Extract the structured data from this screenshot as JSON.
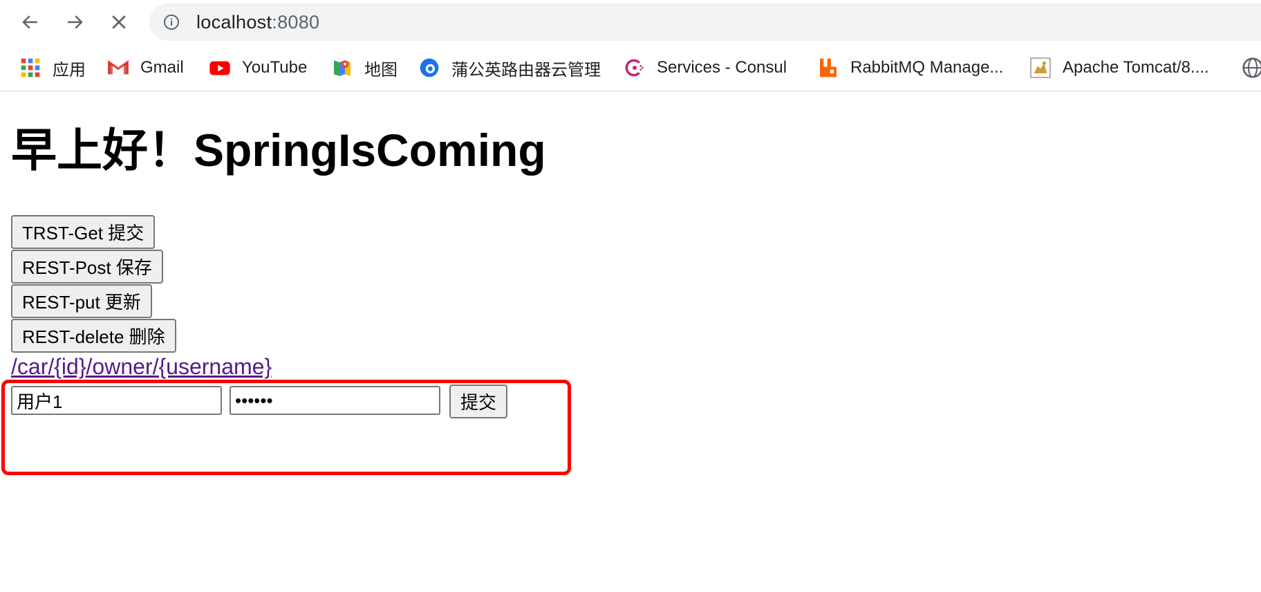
{
  "browser": {
    "url_host": "localhost",
    "url_port": ":8080"
  },
  "bookmarks": [
    {
      "label": "应用",
      "icon": "apps-grid-icon"
    },
    {
      "label": "Gmail",
      "icon": "gmail-icon"
    },
    {
      "label": "YouTube",
      "icon": "youtube-icon"
    },
    {
      "label": "地图",
      "icon": "maps-icon"
    },
    {
      "label": "蒲公英路由器云管理",
      "icon": "pugongying-icon"
    },
    {
      "label": "Services - Consul",
      "icon": "consul-icon"
    },
    {
      "label": "RabbitMQ Manage...",
      "icon": "rabbitmq-icon"
    },
    {
      "label": "Apache Tomcat/8....",
      "icon": "tomcat-icon"
    }
  ],
  "page": {
    "greeting": "早上好！SpringIsComing",
    "buttons": [
      {
        "label": "TRST-Get 提交"
      },
      {
        "label": "REST-Post 保存"
      },
      {
        "label": "REST-put 更新"
      },
      {
        "label": "REST-delete 删除"
      }
    ],
    "link_text": "/car/{id}/owner/{username}",
    "form": {
      "username_value": "用户1",
      "password_value": "123456",
      "submit_label": "提交"
    }
  },
  "colors": {
    "link": "#551a8b",
    "highlight": "#ff0000"
  }
}
